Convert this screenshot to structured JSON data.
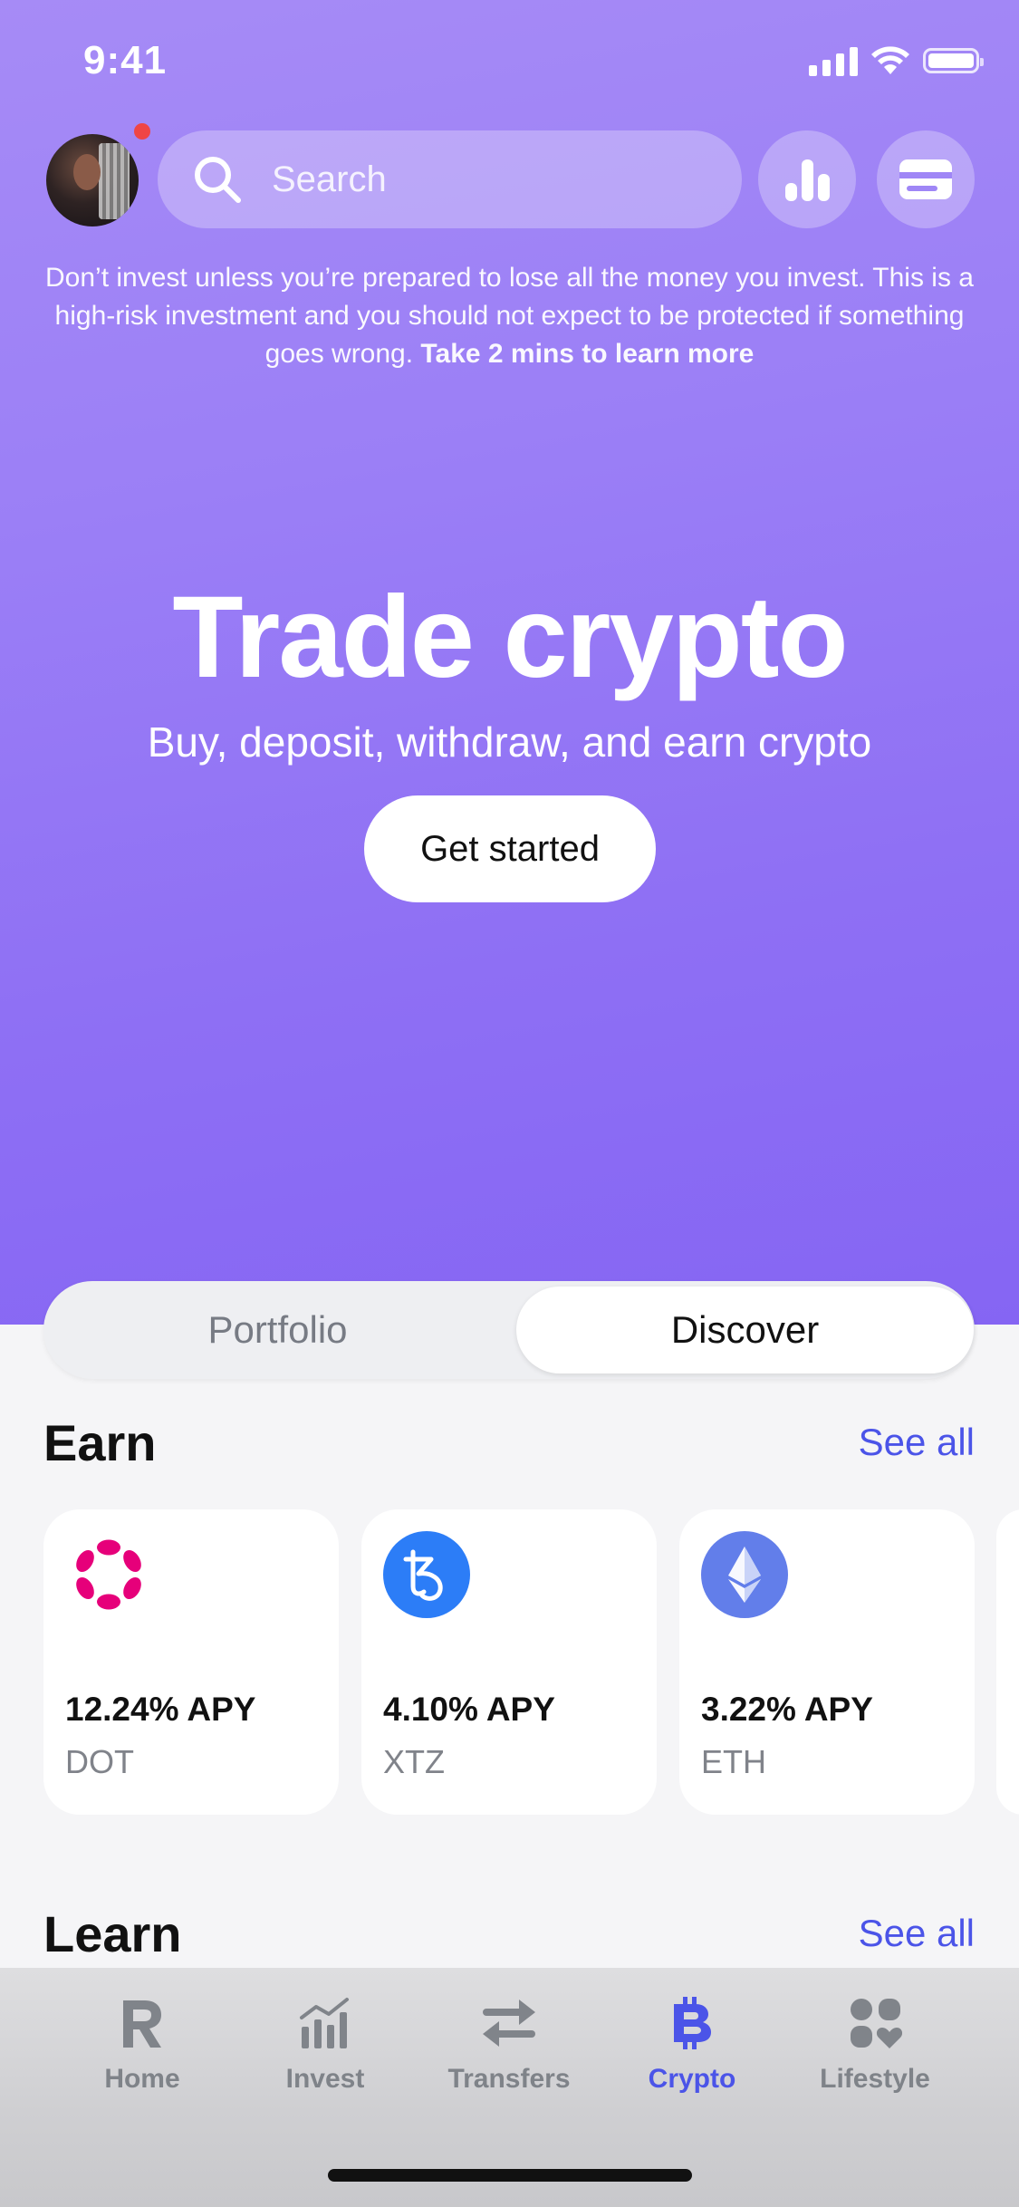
{
  "status_bar": {
    "time": "9:41"
  },
  "header": {
    "search_placeholder": "Search"
  },
  "disclaimer": {
    "text": "Don’t invest unless you’re prepared to lose all the money you invest. This is a high-risk investment and you should not expect to be protected if something goes wrong.",
    "link": "Take 2 mins to learn more"
  },
  "hero": {
    "title": "Trade crypto",
    "subtitle": "Buy, deposit, withdraw, and earn crypto",
    "cta": "Get started"
  },
  "segmented": {
    "tabs": [
      "Portfolio",
      "Discover"
    ],
    "selected": "Discover"
  },
  "earn": {
    "title": "Earn",
    "see_all": "See all",
    "cards": [
      {
        "apy": "12.24% APY",
        "symbol": "DOT",
        "icon": "polkadot-icon",
        "color": "#e6007a"
      },
      {
        "apy": "4.10% APY",
        "symbol": "XTZ",
        "icon": "tezos-icon",
        "color": "#2c7df7"
      },
      {
        "apy": "3.22% APY",
        "symbol": "ETH",
        "icon": "ethereum-icon",
        "color": "#627eea"
      }
    ]
  },
  "learn": {
    "title": "Learn",
    "see_all": "See all"
  },
  "tabbar": {
    "items": [
      {
        "label": "Home",
        "icon": "revolut-r-icon"
      },
      {
        "label": "Invest",
        "icon": "invest-chart-icon"
      },
      {
        "label": "Transfers",
        "icon": "transfer-arrows-icon"
      },
      {
        "label": "Crypto",
        "icon": "bitcoin-icon"
      },
      {
        "label": "Lifestyle",
        "icon": "lifestyle-icon"
      }
    ],
    "active": "Crypto"
  },
  "colors": {
    "hero_gradient_top": "#a68bf6",
    "hero_gradient_bottom": "#8565f3",
    "accent": "#4b54e8",
    "notification": "#ef4545"
  }
}
